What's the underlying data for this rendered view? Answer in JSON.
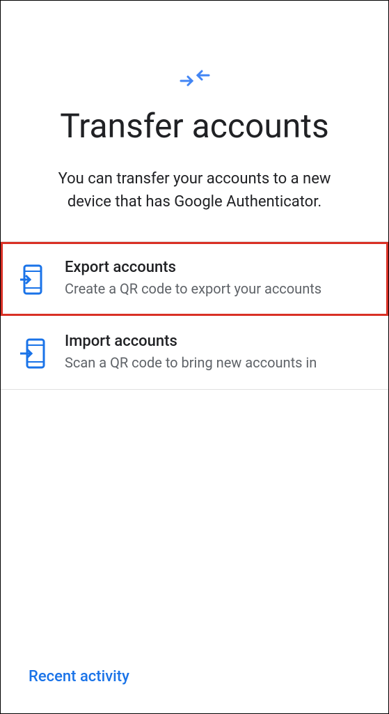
{
  "header": {
    "title": "Transfer accounts",
    "description": "You can transfer your accounts to a new device that has Google Authenticator."
  },
  "options": [
    {
      "title": "Export accounts",
      "subtitle": "Create a QR code to export your accounts",
      "highlighted": true
    },
    {
      "title": "Import accounts",
      "subtitle": "Scan a QR code to bring new accounts in",
      "highlighted": false
    }
  ],
  "footer": {
    "link_label": "Recent activity"
  },
  "colors": {
    "accent": "#1a73e8",
    "highlight": "#d93025",
    "text_primary": "#202124",
    "text_secondary": "#5f6368"
  }
}
